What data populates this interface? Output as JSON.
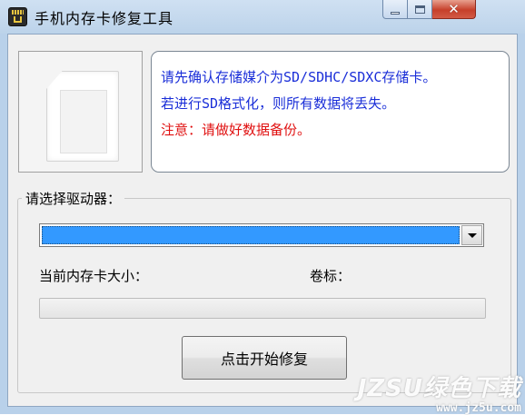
{
  "window": {
    "title": "手机内存卡修复工具",
    "close_glyph": "✕"
  },
  "info": {
    "line1": "请先确认存储媒介为SD/SDHC/SDXC存储卡。",
    "line2": "若进行SD格式化，则所有数据将丢失。",
    "line3": "注意：请做好数据备份。"
  },
  "drive_group": {
    "legend": "请选择驱动器：",
    "selected_drive": "",
    "size_label": "当前内存卡大小：",
    "volume_label": "卷标：",
    "progress": 0,
    "repair_button": "点击开始修复"
  },
  "watermark": {
    "main": "JZSU绿色下载",
    "sub": "www.jz5u.com"
  },
  "colors": {
    "info_blue": "#1a2ed8",
    "warning_red": "#e01010",
    "selection_blue": "#3399ff"
  },
  "icons": [
    "sd-card-icon",
    "minimize-icon",
    "maximize-icon",
    "close-icon",
    "dropdown-arrow-icon"
  ]
}
